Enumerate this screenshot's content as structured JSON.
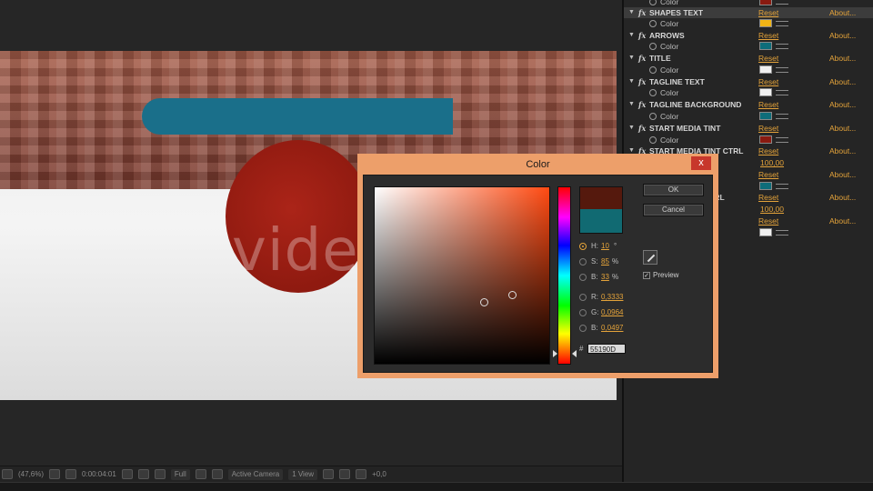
{
  "watermark": "videohive",
  "composition": {
    "headline": "",
    "tagline": "",
    "circle_text": ""
  },
  "viewer_toolbar": {
    "zoom": "(47,6%)",
    "timecode": "0:00:04:01",
    "resolution": "Full",
    "camera": "Active Camera",
    "views": "1 View",
    "exposure": "+0,0"
  },
  "effect_controls": {
    "effects": [
      {
        "name": "SHAPES TEXT",
        "reset": "Reset",
        "about": "About...",
        "param": "Color",
        "swatch": "#f0b416"
      },
      {
        "name": "ARROWS",
        "reset": "Reset",
        "about": "About...",
        "param": "Color",
        "swatch": "#0e6d7a"
      },
      {
        "name": "TITLE",
        "reset": "Reset",
        "about": "About...",
        "param": "Color",
        "swatch": "#f0f0f0"
      },
      {
        "name": "TAGLINE TEXT",
        "reset": "Reset",
        "about": "About...",
        "param": "Color",
        "swatch": "#f0f0f0"
      },
      {
        "name": "TAGLINE BACKGROUND",
        "reset": "Reset",
        "about": "About...",
        "param": "Color",
        "swatch": "#0e6d7a"
      },
      {
        "name": "START MEDIA TINT",
        "reset": "Reset",
        "about": "About...",
        "param": "Color",
        "swatch": "#8a1a10"
      },
      {
        "name": "START MEDIA TINT CTRL",
        "reset": "Reset",
        "about": "About..."
      }
    ],
    "top_partial": {
      "param": "Color",
      "swatch": "#8a1a10"
    },
    "partial_values": [
      "100,00"
    ],
    "partial_swatches": [
      "#0e6d7a"
    ],
    "partial_ctrl_label": "CTRL",
    "partial_resets": [
      "Reset",
      "Reset"
    ],
    "partial_abouts": [
      "About...",
      "About..."
    ],
    "partial_values_2": [
      "100,00"
    ],
    "last_swatch": "#f0f0f0"
  },
  "color_dialog": {
    "title": "Color",
    "close": "x",
    "ok": "OK",
    "cancel": "Cancel",
    "preview_label": "Preview",
    "preview_checked": true,
    "new_color": "#55190d",
    "old_color": "#116a72",
    "hsb": {
      "h_label": "H:",
      "h_value": "10",
      "h_unit": "°",
      "s_label": "S:",
      "s_value": "85",
      "s_unit": "%",
      "b_label": "B:",
      "b_value": "33",
      "b_unit": "%"
    },
    "rgb": {
      "r_label": "R:",
      "r_value": "0,3333",
      "g_label": "G:",
      "g_value": "0,0964",
      "b_label": "B:",
      "b_value": "0,0497"
    },
    "hex_label": "#",
    "hex_value": "55190D"
  }
}
